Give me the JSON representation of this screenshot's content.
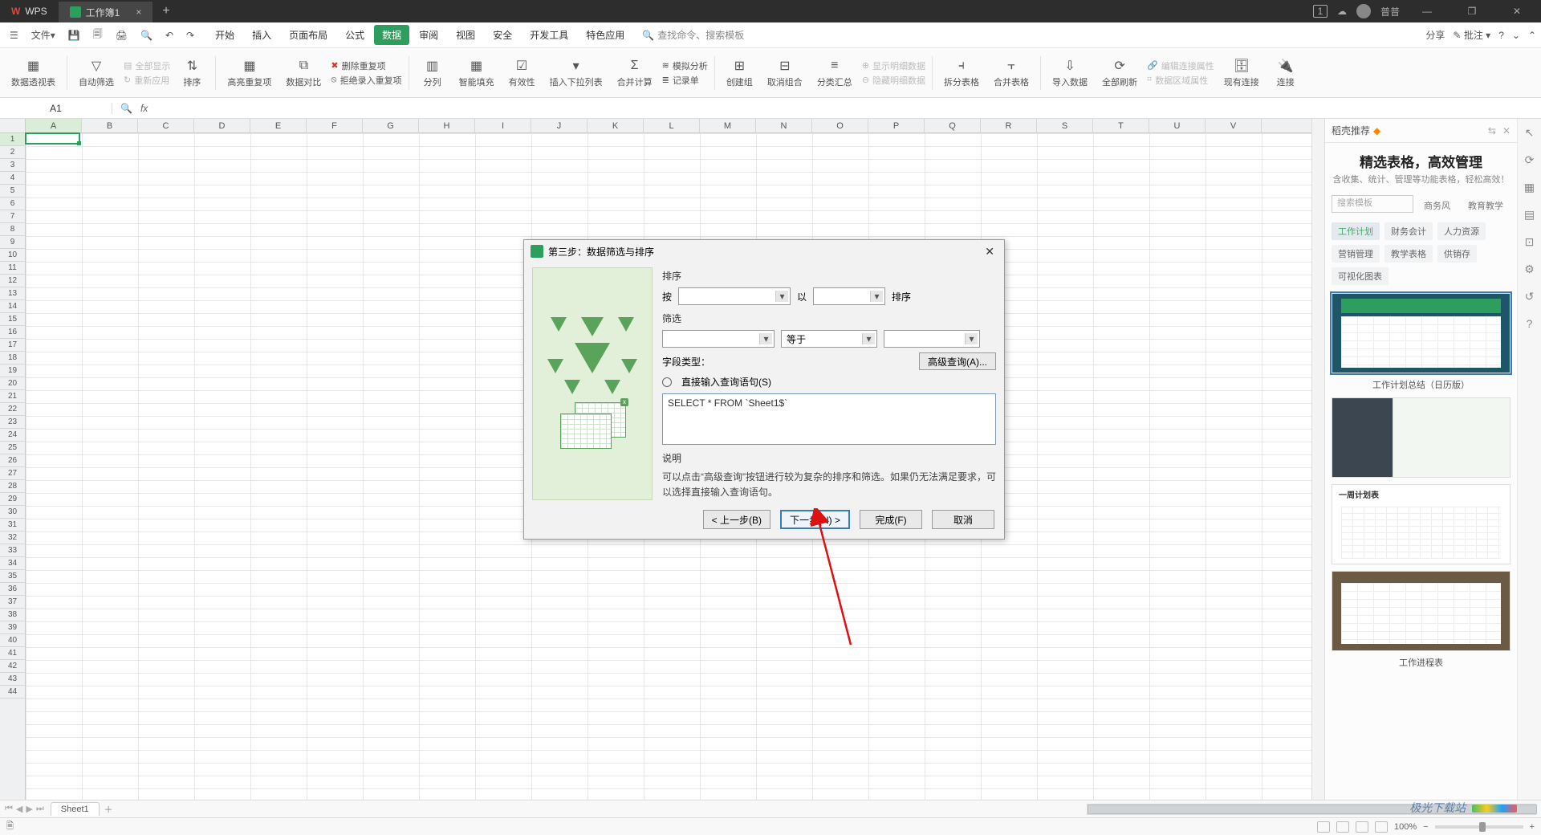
{
  "titlebar": {
    "app": "WPS",
    "doc": "工作簿1",
    "user": "普普",
    "badge": "1"
  },
  "menubar": {
    "file": "文件",
    "tabs": [
      "开始",
      "插入",
      "页面布局",
      "公式",
      "数据",
      "审阅",
      "视图",
      "安全",
      "开发工具",
      "特色应用"
    ],
    "active": "数据",
    "search_placeholder": "查找命令、搜索模板",
    "share": "分享",
    "comment": "批注"
  },
  "ribbon": {
    "pivot": "数据透视表",
    "autofilter": "自动筛选",
    "showall": "全部显示",
    "reapply": "重新应用",
    "sort": "排序",
    "highlight": "高亮重复项",
    "compare": "数据对比",
    "dedup": "删除重复项",
    "reject": "拒绝录入重复项",
    "split": "分列",
    "smartfill": "智能填充",
    "validity": "有效性",
    "dropdown": "插入下拉列表",
    "consolidate": "合并计算",
    "whatif": "模拟分析",
    "form": "记录单",
    "group": "创建组",
    "ungroup": "取消组合",
    "subtotal": "分类汇总",
    "showdetail": "显示明细数据",
    "hidedetail": "隐藏明细数据",
    "splitsheet": "拆分表格",
    "mergesheet": "合并表格",
    "import": "导入数据",
    "refreshall": "全部刷新",
    "editlinks": "编辑连接属性",
    "clearext": "数据区域属性",
    "existing": "现有连接",
    "connect": "连接"
  },
  "fx": {
    "ref": "A1"
  },
  "columns": [
    "A",
    "B",
    "C",
    "D",
    "E",
    "F",
    "G",
    "H",
    "I",
    "J",
    "K",
    "L",
    "M",
    "N",
    "O",
    "P",
    "Q",
    "R",
    "S",
    "T",
    "U",
    "V"
  ],
  "dialog": {
    "title": "第三步：数据筛选与排序",
    "sortlabel": "排序",
    "by": "按",
    "then": "以",
    "order": "排序",
    "filterlabel": "筛选",
    "op": "等于",
    "fieldtype": "字段类型：",
    "adv": "高级查询(A)...",
    "directlabel": "直接输入查询语句(S)",
    "sql": "SELECT * FROM `Sheet1$`",
    "desclabel": "说明",
    "desc": "可以点击“高级查询”按钮进行较为复杂的排序和筛选。如果仍无法满足要求，可以选择直接输入查询语句。",
    "prev": "< 上一步(B)",
    "next": "下一步(N) >",
    "finish": "完成(F)",
    "cancel": "取消"
  },
  "rightpanel": {
    "head": "稻壳推荐",
    "title": "精选表格，高效管理",
    "sub": "含收集、统计、管理等功能表格，轻松高效！",
    "search_placeholder": "搜索模板",
    "chips": [
      "商务风",
      "教育教学"
    ],
    "tags": [
      "工作计划",
      "财务会计",
      "人力资源",
      "营销管理",
      "教学表格",
      "供销存",
      "可视化图表"
    ],
    "tpl1": "工作计划总结（日历版）",
    "tpl2head": "一周计划表",
    "tpl3": "工作进程表"
  },
  "sheettabs": {
    "sheet": "Sheet1"
  },
  "statusbar": {
    "zoom": "100%"
  }
}
